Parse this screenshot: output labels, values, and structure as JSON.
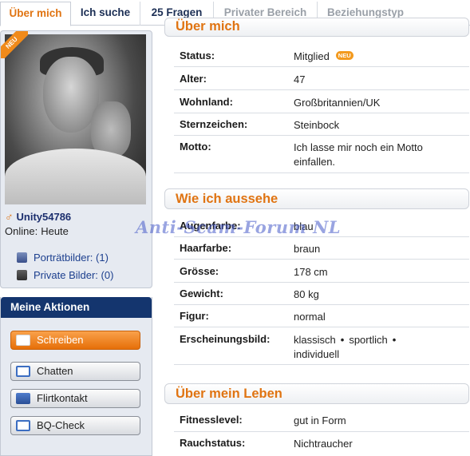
{
  "tabs": [
    {
      "label": "Über mich",
      "state": "active"
    },
    {
      "label": "Ich suche",
      "state": "normal"
    },
    {
      "label": "25 Fragen",
      "state": "normal"
    },
    {
      "label": "Privater Bereich",
      "state": "disabled"
    },
    {
      "label": "Beziehungstyp",
      "state": "disabled"
    }
  ],
  "profile": {
    "badge": "NEU",
    "gender_symbol": "♂",
    "username": "Unity54786",
    "online_label": "Online:",
    "online_value": "Heute",
    "links": [
      {
        "label": "Porträtbilder: (1)",
        "icon": "portrait-icon"
      },
      {
        "label": "Private Bilder: (0)",
        "icon": "lock-icon"
      }
    ]
  },
  "actions": {
    "title": "Meine Aktionen",
    "buttons": [
      {
        "label": "Schreiben",
        "icon": "mail-icon"
      },
      {
        "label": "Chatten",
        "icon": "chat-icon"
      },
      {
        "label": "Flirtkontakt",
        "icon": "flirt-icon"
      },
      {
        "label": "BQ-Check",
        "icon": "heart-icon"
      }
    ]
  },
  "sections": {
    "about": {
      "title": "Über mich",
      "rows": [
        {
          "key": "Status:",
          "value": "Mitglied",
          "badge": "NEU"
        },
        {
          "key": "Alter:",
          "value": "47"
        },
        {
          "key": "Wohnland:",
          "value": "Großbritannien/UK"
        },
        {
          "key": "Sternzeichen:",
          "value": "Steinbock"
        },
        {
          "key": "Motto:",
          "value": "Ich lasse mir noch ein Motto einfallen."
        }
      ]
    },
    "looks": {
      "title": "Wie ich aussehe",
      "rows": [
        {
          "key": "Augenfarbe:",
          "value": "blau"
        },
        {
          "key": "Haarfarbe:",
          "value": "braun"
        },
        {
          "key": "Grösse:",
          "value": "178 cm"
        },
        {
          "key": "Gewicht:",
          "value": "80 kg"
        },
        {
          "key": "Figur:",
          "value": "normal"
        }
      ],
      "appearance_key": "Erscheinungsbild:",
      "appearance_values": [
        "klassisch",
        "sportlich",
        "individuell"
      ]
    },
    "life": {
      "title": "Über mein Leben",
      "rows": [
        {
          "key": "Fitnesslevel:",
          "value": "gut in Form"
        },
        {
          "key": "Rauchstatus:",
          "value": "Nichtraucher"
        }
      ]
    }
  },
  "watermark": "Anti-Scam-Forum NL",
  "colors": {
    "accent": "#e07412",
    "navy": "#14356e",
    "link": "#1c3f8e"
  }
}
